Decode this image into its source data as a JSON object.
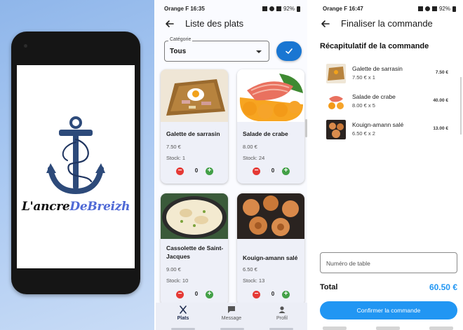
{
  "splash": {
    "logo_part1": "L'ancre",
    "logo_part2": "DeBreizh"
  },
  "status_left": {
    "list_screen": "Orange F  16:35",
    "order_screen": "Orange F  16:47"
  },
  "status_right": {
    "list_screen": "92%",
    "order_screen": "92%"
  },
  "list_screen": {
    "title": "Liste des plats",
    "category_label": "Catégorie",
    "category_value": "Tous",
    "dishes": [
      {
        "name": "Galette de sarrasin",
        "price": "7.50 €",
        "stock": "Stock: 1",
        "quantity": "0"
      },
      {
        "name": "Salade de crabe",
        "price": "8.00 €",
        "stock": "Stock: 24",
        "quantity": "0"
      },
      {
        "name": "Cassolette de Saint-Jacques",
        "price": "9.00 €",
        "stock": "Stock: 10",
        "quantity": "0"
      },
      {
        "name": "Kouign-amann salé",
        "price": "6.50 €",
        "stock": "Stock: 13",
        "quantity": "0"
      }
    ],
    "nav": {
      "plats": "Plats",
      "message": "Message",
      "profil": "Profil"
    }
  },
  "order_screen": {
    "title": "Finaliser la commande",
    "recap_title": "Récapitulatif de la commande",
    "items": [
      {
        "name": "Galette de sarrasin",
        "qty": "7.50 € x 1",
        "total": "7.50 €"
      },
      {
        "name": "Salade de crabe",
        "qty": "8.00 € x 5",
        "total": "40.00 €"
      },
      {
        "name": "Kouign-amann salé",
        "qty": "6.50 € x 2",
        "total": "13.00 €"
      }
    ],
    "table_placeholder": "Numéro de table",
    "total_label": "Total",
    "total_value": "60.50 €",
    "confirm_label": "Confirmer la commande"
  },
  "colors": {
    "primary": "#1976d2",
    "accent_blue": "#2196f3",
    "minus_red": "#e53935",
    "plus_green": "#43a047",
    "logo_blue": "#4f69d6",
    "anchor_navy": "#2d4a7a"
  }
}
